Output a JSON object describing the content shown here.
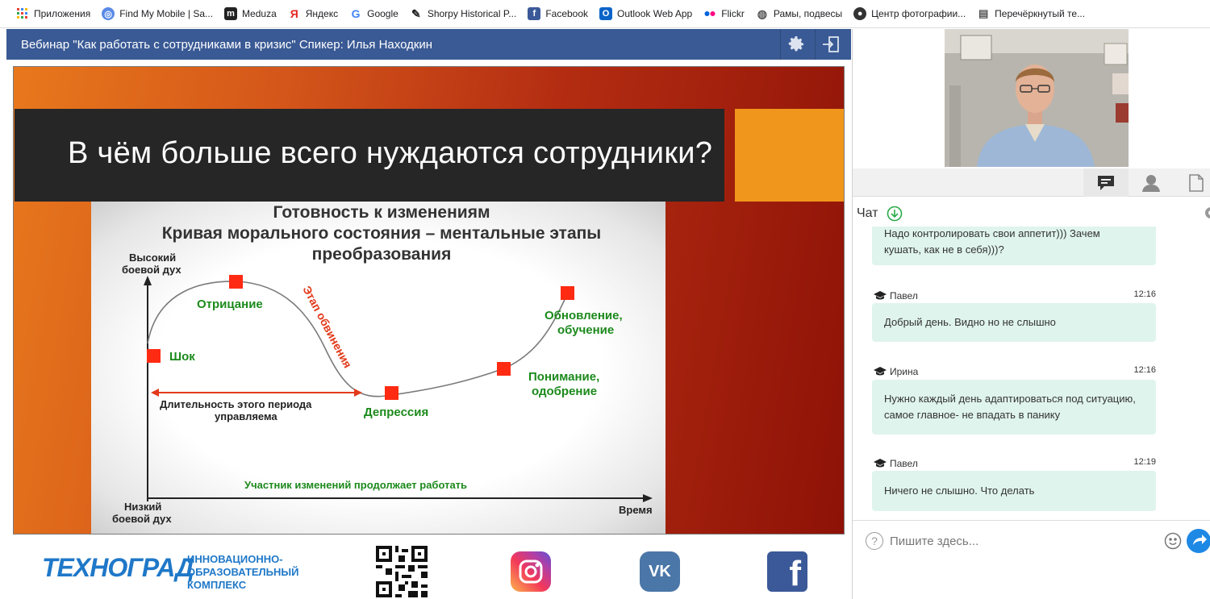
{
  "bookmarks": [
    {
      "label": "Приложения",
      "icon": "apps-grid-icon",
      "color": "#4285f4"
    },
    {
      "label": "Find My Mobile | Sa...",
      "icon": "find-my-mobile-icon",
      "color": "#5a8ae6"
    },
    {
      "label": "Meduza",
      "icon": "meduza-icon",
      "color": "#222222"
    },
    {
      "label": "Яндекс",
      "icon": "yandex-icon",
      "color": "#e52620"
    },
    {
      "label": "Google",
      "icon": "google-icon",
      "color": "#4285f4"
    },
    {
      "label": "Shorpy Historical P...",
      "icon": "shorpy-icon",
      "color": "#222222"
    },
    {
      "label": "Facebook",
      "icon": "facebook-icon",
      "color": "#3b5998"
    },
    {
      "label": "Outlook Web App",
      "icon": "outlook-icon",
      "color": "#0a64c8"
    },
    {
      "label": "Flickr",
      "icon": "flickr-icon",
      "color": "#ff0084"
    },
    {
      "label": "Рамы, подвесы",
      "icon": "globe-icon",
      "color": "#555555"
    },
    {
      "label": "Центр фотографии...",
      "icon": "camera-site-icon",
      "color": "#333333"
    },
    {
      "label": "Перечёркнутый те...",
      "icon": "doc-icon",
      "color": "#555555"
    }
  ],
  "webinar": {
    "title": "Вебинар \"Как работать с сотрудниками в кризис\" Спикер: Илья Находкин"
  },
  "slide": {
    "title": "В чём больше всего нуждаются сотрудники?",
    "colors": {
      "title_bar": "#262626",
      "accent": "#f0961c"
    }
  },
  "diagram": {
    "heading_line1": "Готовность к изменениям",
    "heading_line2": "Кривая морального состояния – ментальные этапы",
    "heading_line3": "преобразования",
    "y_top_line1": "Высокий",
    "y_top_line2": "боевой дух",
    "y_bottom_line1": "Низкий",
    "y_bottom_line2": "боевой дух",
    "x_axis": "Время",
    "stage_shock": "Шок",
    "stage_denial": "Отрицание",
    "stage_blame": "Этап обвинения",
    "stage_depression": "Депрессия",
    "stage_understanding_line1": "Понимание,",
    "stage_understanding_line2": "одобрение",
    "stage_renewal_line1": "Обновление,",
    "stage_renewal_line2": "обучение",
    "duration_line1": "Длительность этого периода",
    "duration_line2": "управляема",
    "footer_note": "Участник изменений продолжает работать"
  },
  "footer": {
    "logo": "ТЕХНОГРАД",
    "logo_sub_line1": "ИННОВАЦИОННО-",
    "logo_sub_line2": "ОБРАЗОВАТЕЛЬНЫЙ",
    "logo_sub_line3": "КОМПЛЕКС",
    "social_letters": {
      "vk": "VK",
      "facebook": "f"
    }
  },
  "chat": {
    "label": "Чат",
    "input_placeholder": "Пишите здесь...",
    "messages": [
      {
        "name": "",
        "time": "",
        "text_line1": "Надо контролировать свои аппетит))) Зачем",
        "text_line2": "кушать, как не в себя)))?"
      },
      {
        "name": "Павел",
        "time": "12:16",
        "text_line1": "Добрый день. Видно но не слышно",
        "text_line2": ""
      },
      {
        "name": "Ирина",
        "time": "12:16",
        "text_line1": "Нужно каждый день адаптироваться под ситуацию,",
        "text_line2": "самое главное- не впадать в панику"
      },
      {
        "name": "Павел",
        "time": "12:19",
        "text_line1": "Ничего не слышно. Что делать",
        "text_line2": ""
      }
    ],
    "colors": {
      "bubble": "#dff4ec",
      "send": "#1e88e5"
    }
  }
}
